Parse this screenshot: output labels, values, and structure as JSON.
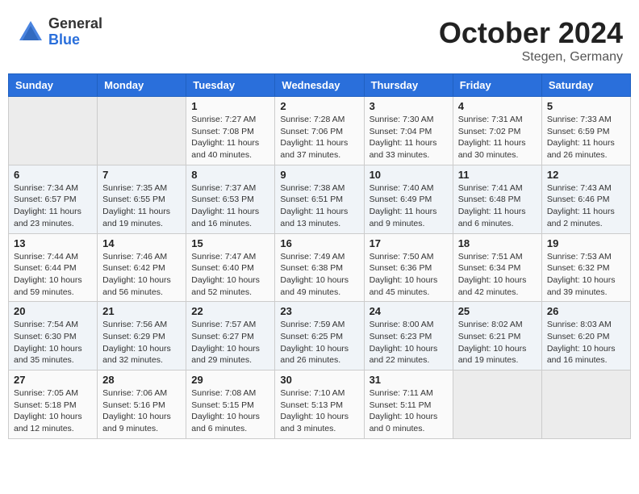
{
  "header": {
    "logo_general": "General",
    "logo_blue": "Blue",
    "month_title": "October 2024",
    "location": "Stegen, Germany"
  },
  "calendar": {
    "headers": [
      "Sunday",
      "Monday",
      "Tuesday",
      "Wednesday",
      "Thursday",
      "Friday",
      "Saturday"
    ],
    "weeks": [
      [
        {
          "day": "",
          "info": ""
        },
        {
          "day": "",
          "info": ""
        },
        {
          "day": "1",
          "info": "Sunrise: 7:27 AM\nSunset: 7:08 PM\nDaylight: 11 hours and 40 minutes."
        },
        {
          "day": "2",
          "info": "Sunrise: 7:28 AM\nSunset: 7:06 PM\nDaylight: 11 hours and 37 minutes."
        },
        {
          "day": "3",
          "info": "Sunrise: 7:30 AM\nSunset: 7:04 PM\nDaylight: 11 hours and 33 minutes."
        },
        {
          "day": "4",
          "info": "Sunrise: 7:31 AM\nSunset: 7:02 PM\nDaylight: 11 hours and 30 minutes."
        },
        {
          "day": "5",
          "info": "Sunrise: 7:33 AM\nSunset: 6:59 PM\nDaylight: 11 hours and 26 minutes."
        }
      ],
      [
        {
          "day": "6",
          "info": "Sunrise: 7:34 AM\nSunset: 6:57 PM\nDaylight: 11 hours and 23 minutes."
        },
        {
          "day": "7",
          "info": "Sunrise: 7:35 AM\nSunset: 6:55 PM\nDaylight: 11 hours and 19 minutes."
        },
        {
          "day": "8",
          "info": "Sunrise: 7:37 AM\nSunset: 6:53 PM\nDaylight: 11 hours and 16 minutes."
        },
        {
          "day": "9",
          "info": "Sunrise: 7:38 AM\nSunset: 6:51 PM\nDaylight: 11 hours and 13 minutes."
        },
        {
          "day": "10",
          "info": "Sunrise: 7:40 AM\nSunset: 6:49 PM\nDaylight: 11 hours and 9 minutes."
        },
        {
          "day": "11",
          "info": "Sunrise: 7:41 AM\nSunset: 6:48 PM\nDaylight: 11 hours and 6 minutes."
        },
        {
          "day": "12",
          "info": "Sunrise: 7:43 AM\nSunset: 6:46 PM\nDaylight: 11 hours and 2 minutes."
        }
      ],
      [
        {
          "day": "13",
          "info": "Sunrise: 7:44 AM\nSunset: 6:44 PM\nDaylight: 10 hours and 59 minutes."
        },
        {
          "day": "14",
          "info": "Sunrise: 7:46 AM\nSunset: 6:42 PM\nDaylight: 10 hours and 56 minutes."
        },
        {
          "day": "15",
          "info": "Sunrise: 7:47 AM\nSunset: 6:40 PM\nDaylight: 10 hours and 52 minutes."
        },
        {
          "day": "16",
          "info": "Sunrise: 7:49 AM\nSunset: 6:38 PM\nDaylight: 10 hours and 49 minutes."
        },
        {
          "day": "17",
          "info": "Sunrise: 7:50 AM\nSunset: 6:36 PM\nDaylight: 10 hours and 45 minutes."
        },
        {
          "day": "18",
          "info": "Sunrise: 7:51 AM\nSunset: 6:34 PM\nDaylight: 10 hours and 42 minutes."
        },
        {
          "day": "19",
          "info": "Sunrise: 7:53 AM\nSunset: 6:32 PM\nDaylight: 10 hours and 39 minutes."
        }
      ],
      [
        {
          "day": "20",
          "info": "Sunrise: 7:54 AM\nSunset: 6:30 PM\nDaylight: 10 hours and 35 minutes."
        },
        {
          "day": "21",
          "info": "Sunrise: 7:56 AM\nSunset: 6:29 PM\nDaylight: 10 hours and 32 minutes."
        },
        {
          "day": "22",
          "info": "Sunrise: 7:57 AM\nSunset: 6:27 PM\nDaylight: 10 hours and 29 minutes."
        },
        {
          "day": "23",
          "info": "Sunrise: 7:59 AM\nSunset: 6:25 PM\nDaylight: 10 hours and 26 minutes."
        },
        {
          "day": "24",
          "info": "Sunrise: 8:00 AM\nSunset: 6:23 PM\nDaylight: 10 hours and 22 minutes."
        },
        {
          "day": "25",
          "info": "Sunrise: 8:02 AM\nSunset: 6:21 PM\nDaylight: 10 hours and 19 minutes."
        },
        {
          "day": "26",
          "info": "Sunrise: 8:03 AM\nSunset: 6:20 PM\nDaylight: 10 hours and 16 minutes."
        }
      ],
      [
        {
          "day": "27",
          "info": "Sunrise: 7:05 AM\nSunset: 5:18 PM\nDaylight: 10 hours and 12 minutes."
        },
        {
          "day": "28",
          "info": "Sunrise: 7:06 AM\nSunset: 5:16 PM\nDaylight: 10 hours and 9 minutes."
        },
        {
          "day": "29",
          "info": "Sunrise: 7:08 AM\nSunset: 5:15 PM\nDaylight: 10 hours and 6 minutes."
        },
        {
          "day": "30",
          "info": "Sunrise: 7:10 AM\nSunset: 5:13 PM\nDaylight: 10 hours and 3 minutes."
        },
        {
          "day": "31",
          "info": "Sunrise: 7:11 AM\nSunset: 5:11 PM\nDaylight: 10 hours and 0 minutes."
        },
        {
          "day": "",
          "info": ""
        },
        {
          "day": "",
          "info": ""
        }
      ]
    ]
  }
}
